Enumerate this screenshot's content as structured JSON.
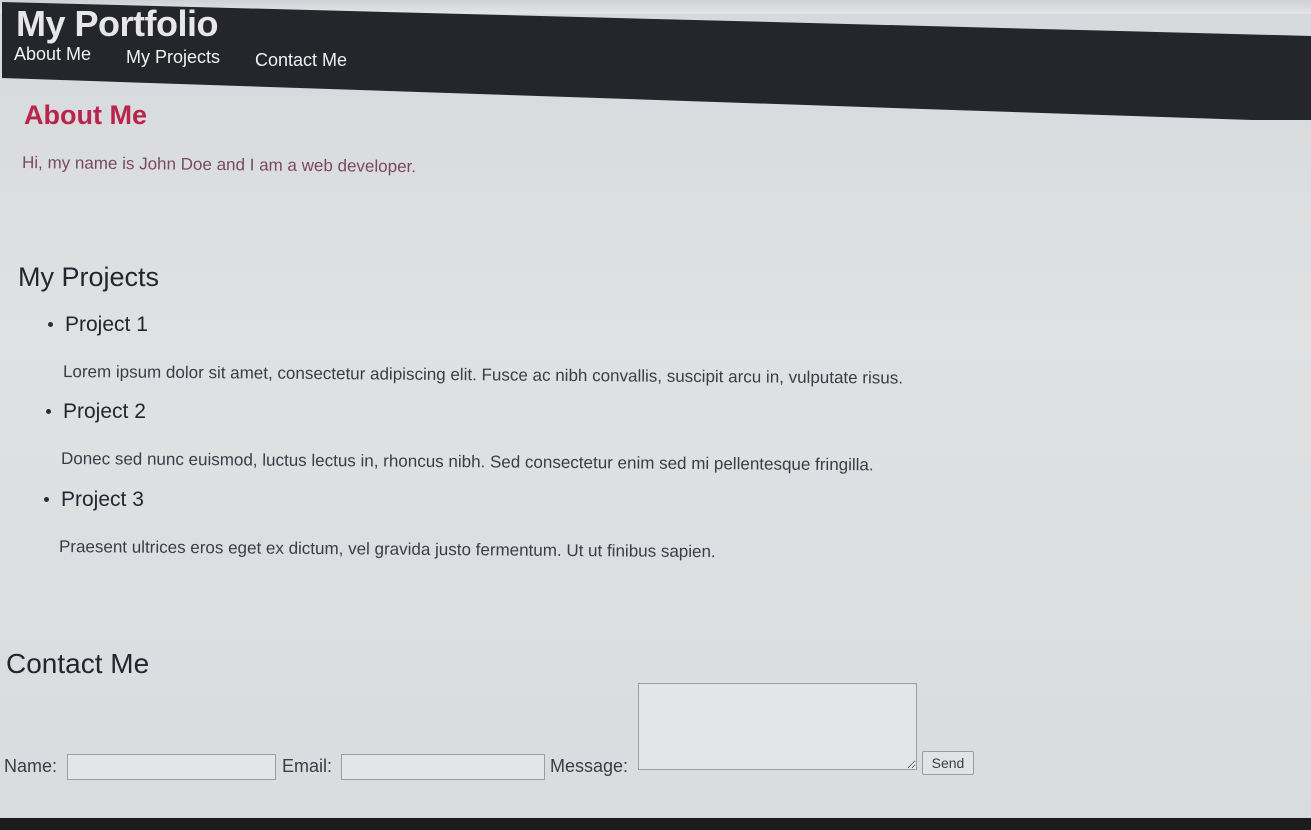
{
  "site": {
    "title": "My Portfolio"
  },
  "nav": {
    "items": [
      {
        "label": "About Me"
      },
      {
        "label": "My Projects"
      },
      {
        "label": "Contact Me"
      }
    ]
  },
  "about": {
    "heading": "About Me",
    "text": "Hi, my name is John Doe and I am a web developer."
  },
  "projects": {
    "heading": "My Projects",
    "items": [
      {
        "title": "Project 1",
        "description": "Lorem ipsum dolor sit amet, consectetur adipiscing elit. Fusce ac nibh convallis, suscipit arcu in, vulputate risus."
      },
      {
        "title": "Project 2",
        "description": "Donec sed nunc euismod, luctus lectus in, rhoncus nibh. Sed consectetur enim sed mi pellentesque fringilla."
      },
      {
        "title": "Project 3",
        "description": "Praesent ultrices eros eget ex dictum, vel gravida justo fermentum. Ut ut finibus sapien."
      }
    ]
  },
  "contact": {
    "heading": "Contact Me",
    "name_label": "Name:",
    "name_value": "",
    "email_label": "Email:",
    "email_value": "",
    "message_label": "Message:",
    "message_value": "",
    "send_label": "Send"
  },
  "colors": {
    "header_bg": "#25262b",
    "about_heading": "#b8244c",
    "about_text": "#7a4a58"
  }
}
